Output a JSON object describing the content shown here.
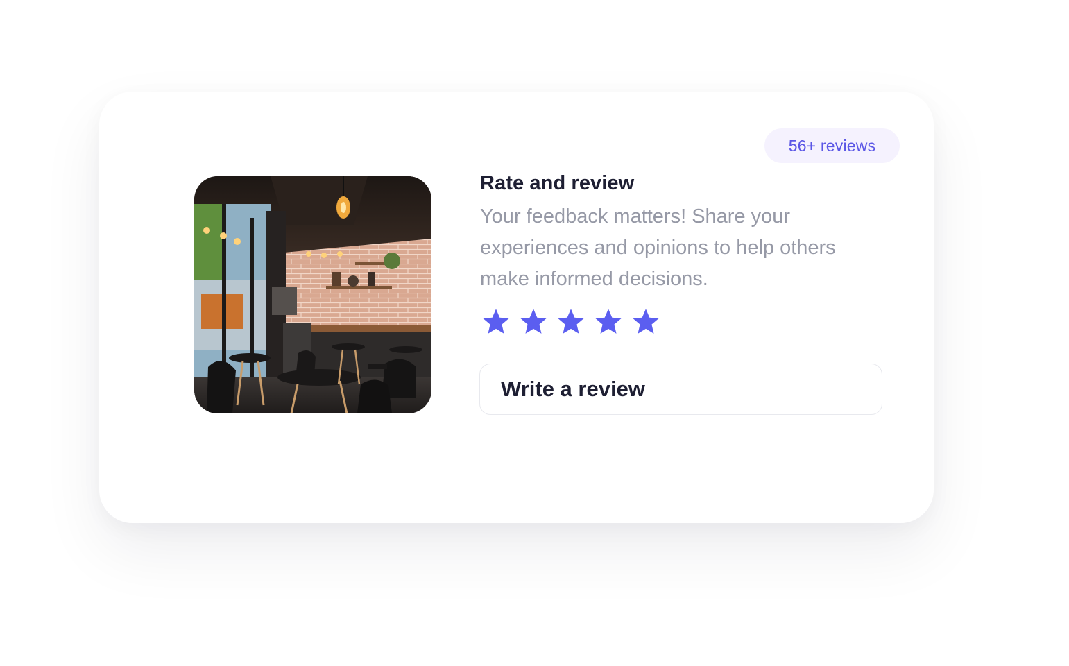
{
  "card": {
    "badge_text": "56+ reviews",
    "title": "Rate and review",
    "description": "Your feedback matters! Share your experiences and opinions to help others make informed decisions.",
    "rating": {
      "value": 5,
      "max": 5
    },
    "write_review_label": "Write a review"
  },
  "colors": {
    "accent": "#5b57e6",
    "badge_bg": "#f5f2fe",
    "title": "#1e1f33",
    "description": "#9699a6",
    "star": "#5b5ef0"
  },
  "icons": {
    "image": "cafe-interior-photo",
    "star": "star-icon"
  }
}
